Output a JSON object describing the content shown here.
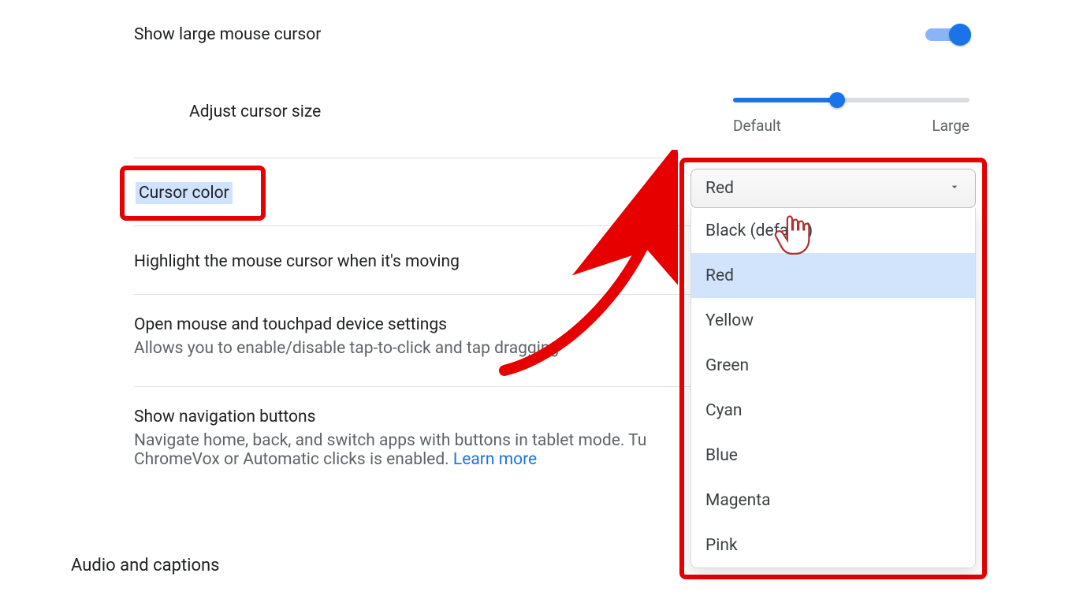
{
  "rows": {
    "show_large_cursor": {
      "label": "Show large mouse cursor",
      "toggle_on": true
    },
    "adjust_cursor_size": {
      "label": "Adjust cursor size",
      "min_label": "Default",
      "max_label": "Large",
      "value_percent": 44
    },
    "cursor_color": {
      "label": "Cursor color",
      "selected": "Red",
      "options": [
        "Black (default)",
        "Red",
        "Yellow",
        "Green",
        "Cyan",
        "Blue",
        "Magenta",
        "Pink"
      ]
    },
    "highlight_moving": {
      "label": "Highlight the mouse cursor when it's moving"
    },
    "open_mouse_touchpad": {
      "label": "Open mouse and touchpad device settings",
      "sub": "Allows you to enable/disable tap-to-click and tap dragging"
    },
    "show_nav_buttons": {
      "label": "Show navigation buttons",
      "sub_prefix": "Navigate home, back, and switch apps with buttons in tablet mode. Tu",
      "sub_suffix": "ChromeVox or Automatic clicks is enabled.  ",
      "learn_more": "Learn more"
    }
  },
  "section": {
    "audio": "Audio and captions"
  },
  "annotation": {
    "highlight_color": "#e60000"
  }
}
